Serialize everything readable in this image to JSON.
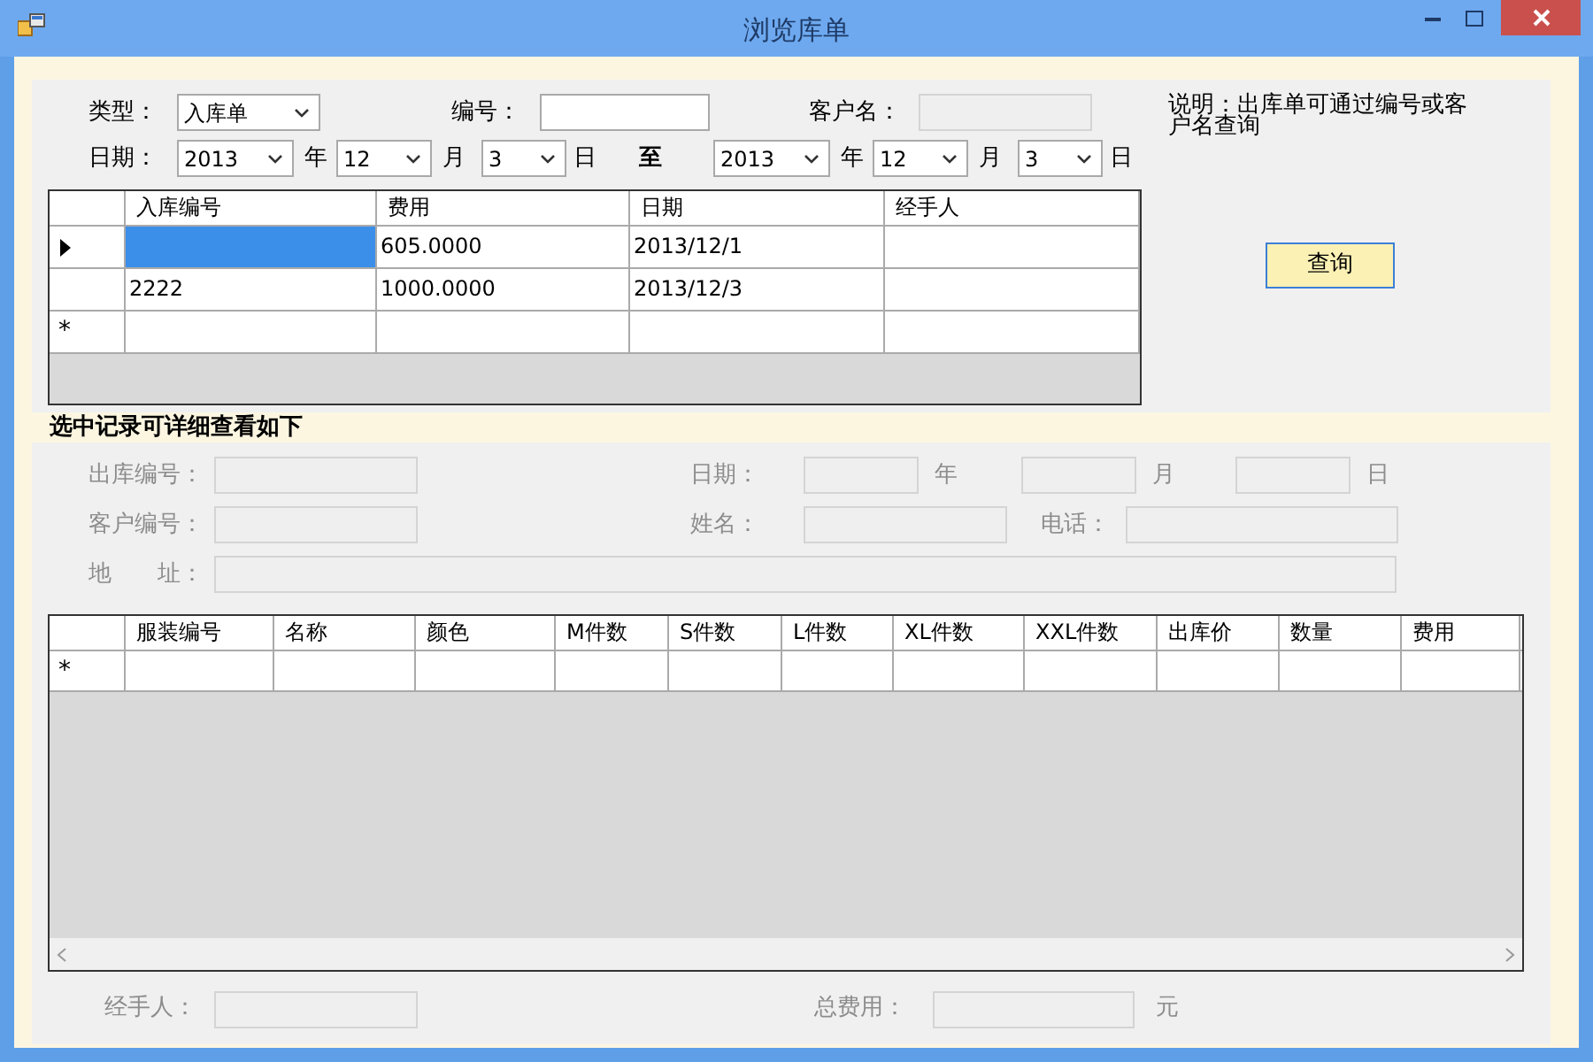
{
  "window": {
    "title": "浏览库单"
  },
  "query": {
    "type": {
      "label": "类型：",
      "value": "入库单"
    },
    "number": {
      "label": "编号："
    },
    "customer": {
      "label": "客户名：",
      "disabled": true
    },
    "date": {
      "label": "日期：",
      "from": {
        "year": "2013",
        "year_unit": "年",
        "month": "12",
        "month_unit": "月",
        "day": "3",
        "day_unit": "日"
      },
      "separator": "至",
      "to": {
        "year": "2013",
        "year_unit": "年",
        "month": "12",
        "month_unit": "月",
        "day": "3",
        "day_unit": "日"
      }
    },
    "note": "说明：出库单可通过编号或客户名查询",
    "search_button": "查询"
  },
  "records_table": {
    "columns": [
      "入库编号",
      "费用",
      "日期",
      "经手人"
    ],
    "rows": [
      {
        "selected": true,
        "cells": [
          null,
          "605.0000",
          "2013/12/1",
          null
        ]
      },
      {
        "selected": false,
        "cells": [
          "2222",
          "1000.0000",
          "2013/12/3",
          null
        ]
      }
    ],
    "new_row_marker": "*"
  },
  "details": {
    "title": "选中记录可详细查看如下",
    "disabled": true,
    "outbound_number_label": "出库编号：",
    "date_label": "日期：",
    "year_unit": "年",
    "month_unit": "月",
    "day_unit": "日",
    "customer_number_label": "客户编号：",
    "name_label": "姓名：",
    "phone_label": "电话：",
    "address_label": "地　　址：",
    "items_table": {
      "columns": [
        "服装编号",
        "名称",
        "颜色",
        "M件数",
        "S件数",
        "L件数",
        "XL件数",
        "XXL件数",
        "出库价",
        "数量",
        "费用"
      ],
      "new_row_marker": "*"
    },
    "handler_label": "经手人：",
    "total_label": "总费用：",
    "currency_unit": "元"
  }
}
